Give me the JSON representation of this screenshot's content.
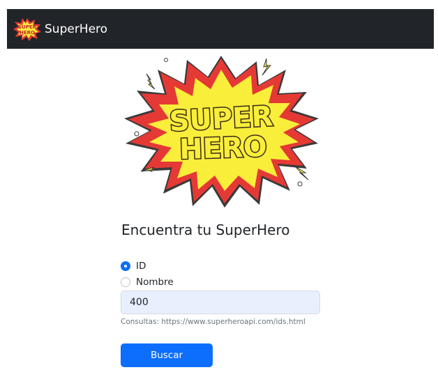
{
  "navbar": {
    "brand_text": "SuperHero",
    "logo_text_line1": "SUPER",
    "logo_text_line2": "HERO"
  },
  "hero_image": {
    "text_line1": "SUPER",
    "text_line2": "HERO",
    "colors": {
      "burst_outer": "#e53935",
      "burst_inner": "#f9ee3a",
      "text_fill": "#f9ee3a",
      "text_outline": "#3a2a1a"
    }
  },
  "main": {
    "heading": "Encuentra tu SuperHero",
    "search_mode": {
      "options": [
        {
          "label": "ID",
          "checked": true
        },
        {
          "label": "Nombre",
          "checked": false
        }
      ]
    },
    "input": {
      "value": "400",
      "placeholder": ""
    },
    "help_text": "Consultas: https://www.superheroapi.com/ids.html",
    "button_label": "Buscar"
  },
  "colors": {
    "navbar_bg": "#212529",
    "primary": "#0d6efd",
    "input_bg": "#e8f0fe"
  }
}
